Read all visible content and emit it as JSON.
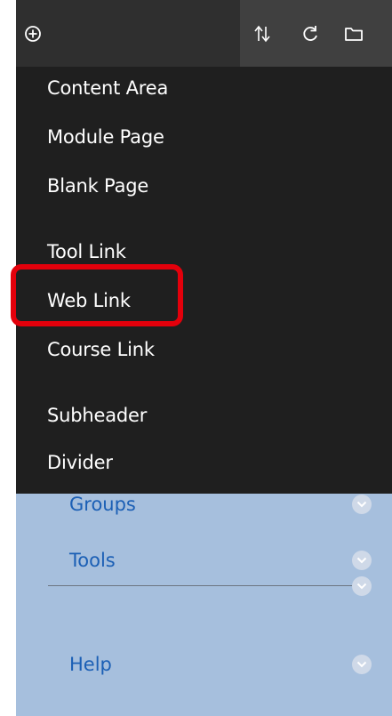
{
  "toolbar": {
    "icons": [
      "add-icon",
      "reorder-icon",
      "refresh-icon",
      "folder-icon"
    ]
  },
  "menu": {
    "items": [
      {
        "label": "Content Area"
      },
      {
        "label": "Module Page"
      },
      {
        "label": "Blank Page"
      },
      {
        "label": "Tool Link"
      },
      {
        "label": "Web Link"
      },
      {
        "label": "Course Link"
      },
      {
        "label": "Subheader"
      },
      {
        "label": "Divider"
      }
    ]
  },
  "course_nav": {
    "items": [
      {
        "label": "Groups"
      },
      {
        "label": "Tools"
      },
      {
        "label": "Help"
      }
    ]
  },
  "colors": {
    "toolbar_bg": "#2f2f2f",
    "menu_bg": "#1f1f1f",
    "nav_bg": "#a6bfdd",
    "nav_link": "#1b5fb5",
    "highlight": "#e3000b"
  }
}
